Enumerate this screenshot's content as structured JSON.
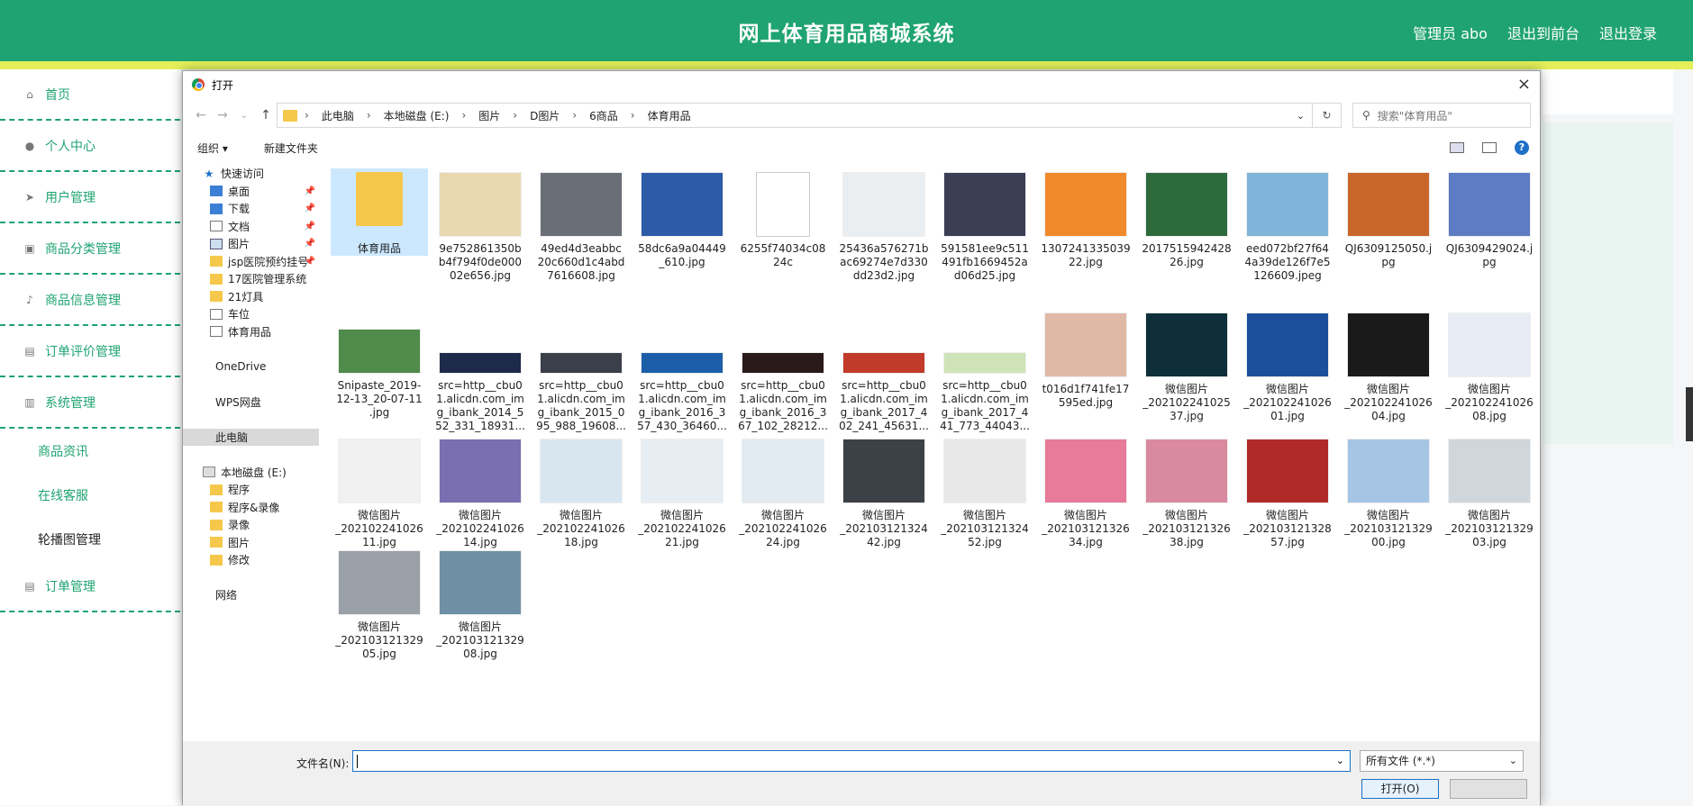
{
  "header": {
    "title": "网上体育用品商城系统",
    "user": "管理员 abo",
    "back_front": "退出到前台",
    "logout": "退出登录"
  },
  "sidebar": {
    "items": [
      {
        "label": "首页",
        "icon": "home-icon"
      },
      {
        "label": "个人中心",
        "icon": "user-icon"
      },
      {
        "label": "用户管理",
        "icon": "send-icon"
      },
      {
        "label": "商品分类管理",
        "icon": "briefcase-icon"
      },
      {
        "label": "商品信息管理",
        "icon": "mic-icon"
      },
      {
        "label": "订单评价管理",
        "icon": "print-icon"
      },
      {
        "label": "系统管理",
        "icon": "bar-chart-icon"
      }
    ],
    "subitems": [
      "商品资讯",
      "在线客服",
      "轮播图管理"
    ],
    "last": {
      "label": "订单管理",
      "icon": "print-icon"
    }
  },
  "dialog": {
    "title": "打开",
    "close": "×",
    "breadcrumb": [
      "此电脑",
      "本地磁盘 (E:)",
      "图片",
      "D图片",
      "6商品",
      "体育用品"
    ],
    "search_placeholder": "搜索\"体育用品\"",
    "organize": "组织 ▾",
    "new_folder": "新建文件夹",
    "nav_pane": [
      {
        "label": "快速访问",
        "icon": "star",
        "pin": false
      },
      {
        "label": "桌面",
        "icon": "blue",
        "pin": true
      },
      {
        "label": "下载",
        "icon": "blue",
        "pin": true
      },
      {
        "label": "文档",
        "icon": "doc",
        "pin": true
      },
      {
        "label": "图片",
        "icon": "pc",
        "pin": true
      },
      {
        "label": "jsp医院预约挂号",
        "icon": "fold",
        "pin": true
      },
      {
        "label": "17医院管理系统",
        "icon": "fold",
        "pin": false
      },
      {
        "label": "21灯具",
        "icon": "fold",
        "pin": false
      },
      {
        "label": "车位",
        "icon": "doc",
        "pin": false
      },
      {
        "label": "体育用品",
        "icon": "doc",
        "pin": false
      },
      {
        "label": "",
        "icon": "",
        "pin": false
      },
      {
        "label": "OneDrive",
        "icon": "",
        "pin": false
      },
      {
        "label": "",
        "icon": "",
        "pin": false
      },
      {
        "label": "WPS网盘",
        "icon": "",
        "pin": false
      },
      {
        "label": "",
        "icon": "",
        "pin": false
      },
      {
        "label": "此电脑",
        "icon": "",
        "pin": false,
        "selected": true
      },
      {
        "label": "",
        "icon": "",
        "pin": false
      },
      {
        "label": "本地磁盘 (E:)",
        "icon": "drive",
        "pin": false
      },
      {
        "label": "程序",
        "icon": "fold",
        "pin": false
      },
      {
        "label": "程序&录像",
        "icon": "fold",
        "pin": false
      },
      {
        "label": "录像",
        "icon": "fold",
        "pin": false
      },
      {
        "label": "图片",
        "icon": "fold",
        "pin": false
      },
      {
        "label": "修改",
        "icon": "fold",
        "pin": false
      },
      {
        "label": "",
        "icon": "",
        "pin": false
      },
      {
        "label": "网络",
        "icon": "",
        "pin": false
      }
    ],
    "files": [
      {
        "name": "体育用品",
        "type": "folder",
        "color": "#f5c84c"
      },
      {
        "name": "9e752861350b\nb4f794f0de000\n02e656.jpg",
        "color": "#e9d8b0"
      },
      {
        "name": "49ed4d3eabbc\n20c660d1c4abd\n7616608.jpg",
        "color": "#6a6f77"
      },
      {
        "name": "58dc6a9a04449\n_610.jpg",
        "color": "#2d5ba8"
      },
      {
        "name": "6255f74034c08\n24c",
        "type": "blank",
        "color": "#ffffff"
      },
      {
        "name": "25436a576271b\nac69274e7d330\ndd23d2.jpg",
        "color": "#eaeef0"
      },
      {
        "name": "591581ee9c511\n491fb1669452a\nd06d25.jpg",
        "color": "#3a3f55"
      },
      {
        "name": "1307241335039\n22.jpg",
        "color": "#f08a2a"
      },
      {
        "name": "2017515942428\n26.jpg",
        "color": "#2e6b3c"
      },
      {
        "name": "eed072bf27f64\n4a39de126f7e5\n126609.jpeg",
        "color": "#7fb5d8"
      },
      {
        "name": "QJ6309125050.j\npg",
        "color": "#c9672a"
      },
      {
        "name": "QJ6309429024.j\npg",
        "color": "#5d7cc4"
      },
      {
        "name": "Snipaste_2019-\n12-13_20-07-11\n.jpg",
        "color": "#4f8b4a"
      },
      {
        "name": "src=http__cbu0\n1.alicdn.com_im\ng_ibank_2014_5\n52_331_18931...",
        "color": "#1d2a4a"
      },
      {
        "name": "src=http__cbu0\n1.alicdn.com_im\ng_ibank_2015_0\n95_988_19608...",
        "color": "#3b3f4a"
      },
      {
        "name": "src=http__cbu0\n1.alicdn.com_im\ng_ibank_2016_3\n57_430_36460...",
        "color": "#1c5fa8"
      },
      {
        "name": "src=http__cbu0\n1.alicdn.com_im\ng_ibank_2016_3\n67_102_28212...",
        "color": "#2a1a1a"
      },
      {
        "name": "src=http__cbu0\n1.alicdn.com_im\ng_ibank_2017_4\n02_241_45631...",
        "color": "#c23a2a"
      },
      {
        "name": "src=http__cbu0\n1.alicdn.com_im\ng_ibank_2017_4\n41_773_44043...",
        "color": "#cfe3b8"
      },
      {
        "name": "t016d1f741fe17\n595ed.jpg",
        "color": "#e0b8a6"
      },
      {
        "name": "微信图片\n_202102241025\n37.jpg",
        "color": "#0e2f3a"
      },
      {
        "name": "微信图片\n_202102241026\n01.jpg",
        "color": "#1b4f9c"
      },
      {
        "name": "微信图片\n_202102241026\n04.jpg",
        "color": "#1a1a1a"
      },
      {
        "name": "微信图片\n_202102241026\n08.jpg",
        "color": "#e7ecf5"
      },
      {
        "name": "微信图片\n_202102241026\n11.jpg",
        "color": "#f1f1f1"
      },
      {
        "name": "微信图片\n_202102241026\n14.jpg",
        "color": "#7a6fb0"
      },
      {
        "name": "微信图片\n_202102241026\n18.jpg",
        "color": "#d8e6f0"
      },
      {
        "name": "微信图片\n_202102241026\n21.jpg",
        "color": "#e6eef3"
      },
      {
        "name": "微信图片\n_202102241026\n24.jpg",
        "color": "#e2ebf1"
      },
      {
        "name": "微信图片\n_202103121324\n42.jpg",
        "color": "#3c4047"
      },
      {
        "name": "微信图片\n_202103121324\n52.jpg",
        "color": "#e8e8e8"
      },
      {
        "name": "微信图片\n_202103121326\n34.jpg",
        "color": "#e87a9a"
      },
      {
        "name": "微信图片\n_202103121326\n38.jpg",
        "color": "#d98aa0"
      },
      {
        "name": "微信图片\n_202103121328\n57.jpg",
        "color": "#b12a2a"
      },
      {
        "name": "微信图片\n_202103121329\n00.jpg",
        "color": "#a6c4e4"
      },
      {
        "name": "微信图片\n_202103121329\n03.jpg",
        "color": "#cfd6dc"
      },
      {
        "name": "微信图片\n_202103121329\n05.jpg",
        "color": "#9aa0a8"
      },
      {
        "name": "微信图片\n_202103121329\n08.jpg",
        "color": "#6f8fa4"
      }
    ],
    "filename_label": "文件名(N):",
    "filename_value": "",
    "filetype": "所有文件 (*.*)",
    "open_button": "打开(O)",
    "cancel_button": ""
  }
}
